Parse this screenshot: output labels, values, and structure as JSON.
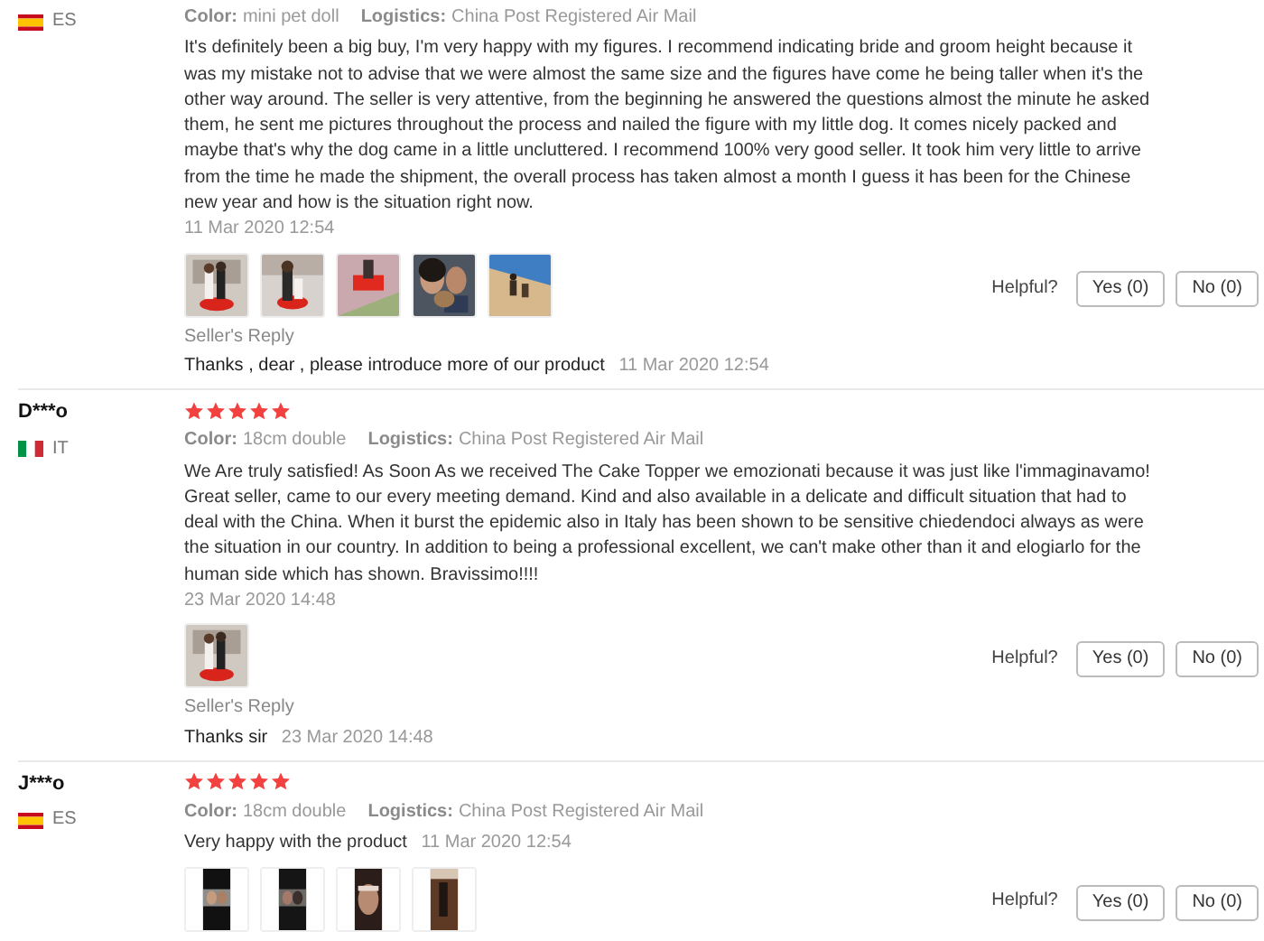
{
  "reviews": [
    {
      "country": "ES",
      "flag": {
        "kind": "horizontal",
        "stripes": [
          {
            "color": "#c60b1e"
          },
          {
            "color": "#ffc400"
          },
          {
            "color": "#c60b1e"
          }
        ]
      },
      "variant": {
        "label": "Color:",
        "value": "mini pet doll"
      },
      "logistics": {
        "label": "Logistics:",
        "value": "China Post Registered Air Mail"
      },
      "text": "It's definitely been a big buy, I'm very happy with my figures. I recommend indicating bride and groom height because it was my mistake not to advise that we were almost the same size and the figures have come he being taller when it's the other way around. The seller is very attentive, from the beginning he answered the questions almost the minute he asked them, he sent me pictures throughout the process and nailed the figure with my little dog. It comes nicely packed and maybe that's why the dog came in a little uncluttered. I recommend 100% very good seller. It took him very little to arrive from the time he made the shipment, the overall process has taken almost a month I guess it has been for the Chinese new year and how is the situation right now.",
      "date": "11 Mar 2020 12:54",
      "photos": [
        {
          "kind": "picture"
        },
        {
          "kind": "picture"
        },
        {
          "kind": "picture"
        },
        {
          "kind": "picture"
        },
        {
          "kind": "picture"
        }
      ],
      "helpful": {
        "label": "Helpful?",
        "yes": "Yes (0)",
        "no": "No (0)"
      },
      "reply": {
        "label": "Seller's Reply",
        "text": "Thanks , dear , please introduce more of our product",
        "date": "11 Mar 2020 12:54"
      }
    },
    {
      "user": "D***o",
      "stars": 5,
      "country": "IT",
      "flag": {
        "kind": "vertical",
        "stripes": [
          {
            "color": "#009246"
          },
          {
            "color": "#ffffff"
          },
          {
            "color": "#ce2b37"
          }
        ]
      },
      "variant": {
        "label": "Color:",
        "value": "18cm double"
      },
      "logistics": {
        "label": "Logistics:",
        "value": "China Post Registered Air Mail"
      },
      "text": "We Are truly satisfied! As Soon As we received The Cake Topper we emozionati because it was just like l'immaginavamo! Great seller, came to our every meeting demand. Kind and also available in a delicate and difficult situation that had to deal with the China. When it burst the epidemic also in Italy has been shown to be sensitive chiedendoci always as were the situation in our country. In addition to being a professional excellent, we can't make other than it and elogiarlo for the human side which has shown. Bravissimo!!!!",
      "date": "23 Mar 2020 14:48",
      "photos": [
        {
          "kind": "picture"
        }
      ],
      "helpful": {
        "label": "Helpful?",
        "yes": "Yes (0)",
        "no": "No (0)"
      },
      "reply": {
        "label": "Seller's Reply",
        "text": "Thanks sir",
        "date": "23 Mar 2020 14:48"
      }
    },
    {
      "user": "J***o",
      "stars": 5,
      "country": "ES",
      "flag": {
        "kind": "horizontal",
        "stripes": [
          {
            "color": "#c60b1e"
          },
          {
            "color": "#ffc400"
          },
          {
            "color": "#c60b1e"
          }
        ]
      },
      "variant": {
        "label": "Color:",
        "value": "18cm double"
      },
      "logistics": {
        "label": "Logistics:",
        "value": "China Post Registered Air Mail"
      },
      "text": "Very happy with the product",
      "date": "11 Mar 2020 12:54",
      "photos": [
        {
          "kind": "picture"
        },
        {
          "kind": "picture"
        },
        {
          "kind": "picture"
        },
        {
          "kind": "picture"
        }
      ],
      "helpful": {
        "label": "Helpful?",
        "yes": "Yes (0)",
        "no": "No (0)"
      }
    }
  ]
}
